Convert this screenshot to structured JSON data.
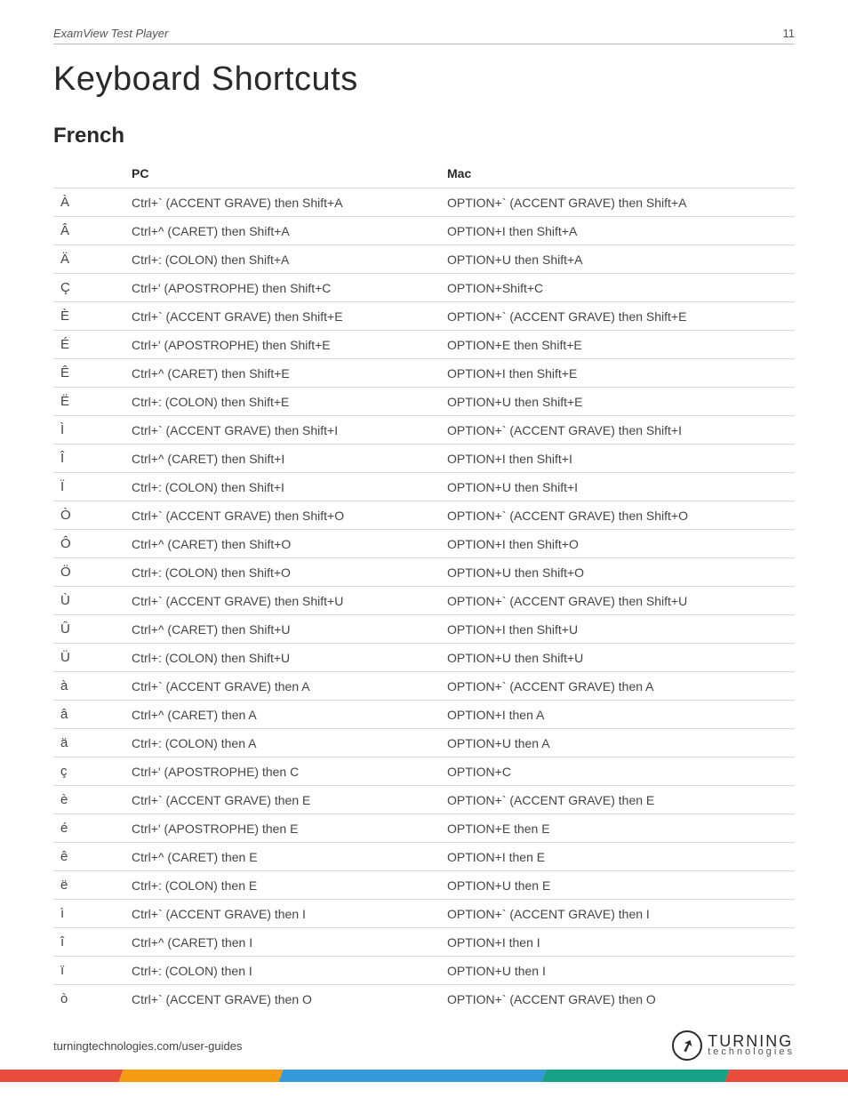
{
  "header": {
    "product": "ExamView Test Player",
    "page_number": "11"
  },
  "title": "Keyboard Shortcuts",
  "section": "French",
  "columns": {
    "char": "",
    "pc": "PC",
    "mac": "Mac"
  },
  "rows": [
    {
      "char": "À",
      "pc": "Ctrl+` (ACCENT GRAVE) then Shift+A",
      "mac": "OPTION+` (ACCENT GRAVE) then Shift+A"
    },
    {
      "char": "Â",
      "pc": "Ctrl+^ (CARET) then Shift+A",
      "mac": "OPTION+I then Shift+A"
    },
    {
      "char": "Ä",
      "pc": "Ctrl+: (COLON) then Shift+A",
      "mac": "OPTION+U then Shift+A"
    },
    {
      "char": "Ç",
      "pc": "Ctrl+' (APOSTROPHE) then Shift+C",
      "mac": "OPTION+Shift+C"
    },
    {
      "char": "È",
      "pc": "Ctrl+` (ACCENT GRAVE) then Shift+E",
      "mac": "OPTION+` (ACCENT GRAVE) then Shift+E"
    },
    {
      "char": "É",
      "pc": "Ctrl+' (APOSTROPHE) then Shift+E",
      "mac": "OPTION+E then Shift+E"
    },
    {
      "char": "Ê",
      "pc": "Ctrl+^ (CARET) then Shift+E",
      "mac": "OPTION+I then Shift+E"
    },
    {
      "char": "Ë",
      "pc": "Ctrl+: (COLON) then Shift+E",
      "mac": "OPTION+U then Shift+E"
    },
    {
      "char": "Ì",
      "pc": "Ctrl+` (ACCENT GRAVE) then Shift+I",
      "mac": "OPTION+` (ACCENT GRAVE) then Shift+I"
    },
    {
      "char": "Î",
      "pc": "Ctrl+^ (CARET) then Shift+I",
      "mac": "OPTION+I then Shift+I"
    },
    {
      "char": "Ï",
      "pc": "Ctrl+: (COLON) then Shift+I",
      "mac": "OPTION+U then Shift+I"
    },
    {
      "char": "Ò",
      "pc": "Ctrl+` (ACCENT GRAVE) then Shift+O",
      "mac": "OPTION+` (ACCENT GRAVE) then Shift+O"
    },
    {
      "char": "Ô",
      "pc": "Ctrl+^ (CARET) then Shift+O",
      "mac": "OPTION+I then Shift+O"
    },
    {
      "char": "Ö",
      "pc": "Ctrl+: (COLON) then Shift+O",
      "mac": "OPTION+U then Shift+O"
    },
    {
      "char": "Ù",
      "pc": "Ctrl+` (ACCENT GRAVE) then Shift+U",
      "mac": "OPTION+` (ACCENT GRAVE) then Shift+U"
    },
    {
      "char": "Û",
      "pc": "Ctrl+^ (CARET) then Shift+U",
      "mac": "OPTION+I then Shift+U"
    },
    {
      "char": "Ü",
      "pc": "Ctrl+: (COLON) then Shift+U",
      "mac": "OPTION+U then Shift+U"
    },
    {
      "char": "à",
      "pc": "Ctrl+` (ACCENT GRAVE) then A",
      "mac": "OPTION+` (ACCENT GRAVE) then A"
    },
    {
      "char": "â",
      "pc": "Ctrl+^ (CARET) then A",
      "mac": "OPTION+I then A"
    },
    {
      "char": "ä",
      "pc": "Ctrl+: (COLON) then A",
      "mac": "OPTION+U then A"
    },
    {
      "char": "ç",
      "pc": "Ctrl+' (APOSTROPHE) then C",
      "mac": "OPTION+C"
    },
    {
      "char": "è",
      "pc": "Ctrl+` (ACCENT GRAVE) then E",
      "mac": "OPTION+` (ACCENT GRAVE) then E"
    },
    {
      "char": "é",
      "pc": "Ctrl+' (APOSTROPHE) then E",
      "mac": "OPTION+E then E"
    },
    {
      "char": "ê",
      "pc": "Ctrl+^ (CARET) then E",
      "mac": "OPTION+I then E"
    },
    {
      "char": "ë",
      "pc": "Ctrl+: (COLON) then E",
      "mac": "OPTION+U then E"
    },
    {
      "char": "ì",
      "pc": "Ctrl+` (ACCENT GRAVE) then I",
      "mac": "OPTION+` (ACCENT GRAVE) then I"
    },
    {
      "char": "î",
      "pc": "Ctrl+^ (CARET) then I",
      "mac": "OPTION+I then I"
    },
    {
      "char": "ï",
      "pc": "Ctrl+: (COLON) then I",
      "mac": "OPTION+U then I"
    },
    {
      "char": "ò",
      "pc": "Ctrl+` (ACCENT GRAVE) then O",
      "mac": "OPTION+` (ACCENT GRAVE) then O"
    }
  ],
  "footer": {
    "link_text": "turningtechnologies.com/user-guides",
    "logo_top": "TURNING",
    "logo_bottom": "technologies"
  }
}
